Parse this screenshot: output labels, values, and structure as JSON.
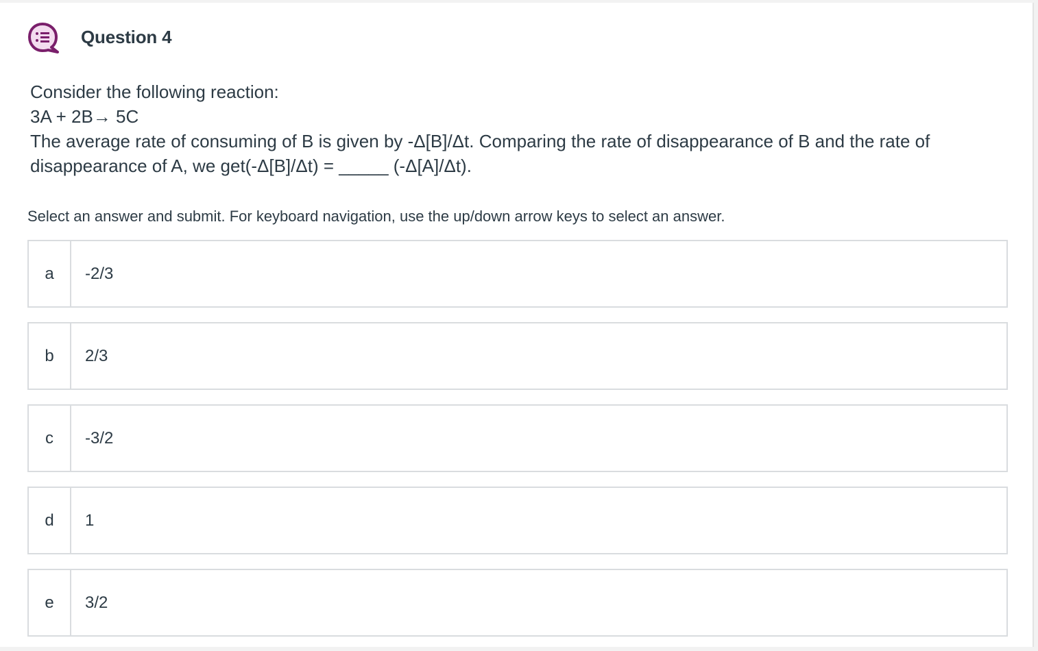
{
  "question": {
    "title": "Question 4",
    "icon": "multiple-choice-bubble-icon",
    "prompt_lines": [
      "Consider the following reaction:",
      "3A + 2B→ 5C",
      "The average rate of consuming of B is given by -Δ[B]/Δt. Comparing the rate of disappearance of B and the rate of",
      "disappearance of A, we get(-Δ[B]/Δt) = _____ (-Δ[A]/Δt)."
    ]
  },
  "instruction": "Select an answer and submit. For keyboard navigation, use the up/down arrow keys to select an answer.",
  "answers": [
    {
      "letter": "a",
      "text": "-2/3"
    },
    {
      "letter": "b",
      "text": "2/3"
    },
    {
      "letter": "c",
      "text": "-3/2"
    },
    {
      "letter": "d",
      "text": "1"
    },
    {
      "letter": "e",
      "text": "3/2"
    }
  ],
  "colors": {
    "icon_accent": "#7a1f6b",
    "icon_fill": "#f3dcef",
    "text": "#2d3b45",
    "border": "#d9dcdf"
  }
}
